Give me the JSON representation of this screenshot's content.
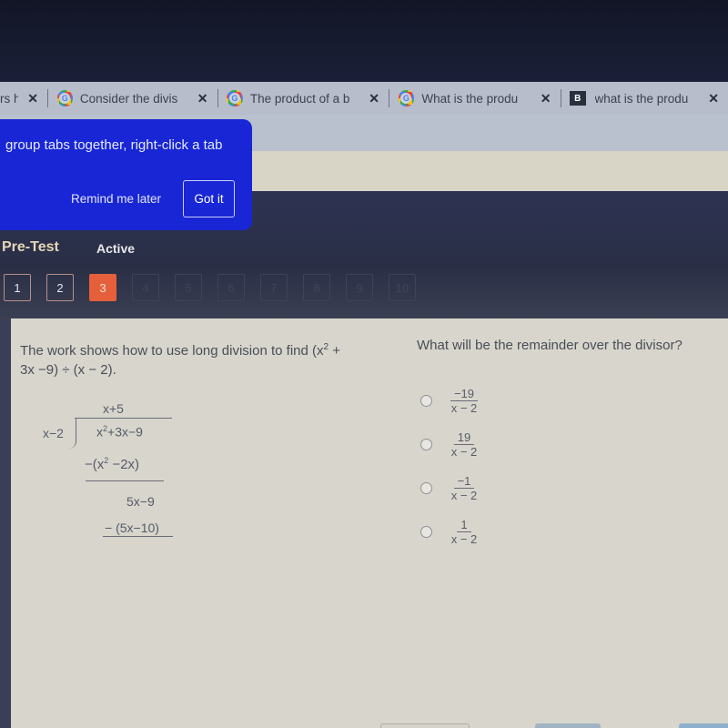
{
  "browser": {
    "tabs": [
      {
        "title": "rs h",
        "icon": "none",
        "close": "✕"
      },
      {
        "title": "Consider the divis",
        "icon": "google-icon",
        "close": "✕"
      },
      {
        "title": "The product of a b",
        "icon": "google-icon",
        "close": "✕"
      },
      {
        "title": "What is the produ",
        "icon": "google-icon",
        "close": "✕"
      },
      {
        "title": "what is the produ",
        "icon": "brainly-icon",
        "close": "✕"
      }
    ],
    "google_glyph": "G",
    "brainly_glyph": "B"
  },
  "popup": {
    "message": "group tabs together, right-click a tab",
    "remind_label": "Remind me later",
    "gotit_label": "Got it",
    "color": "#1826d6"
  },
  "header": {
    "title": "Pre-Test",
    "status": "Active"
  },
  "question_nav": {
    "items": [
      "1",
      "2",
      "3",
      "4",
      "5",
      "6",
      "7",
      "8",
      "9",
      "10"
    ],
    "current": 3,
    "current_color": "#e5603a"
  },
  "question": {
    "line1_pre": "The work shows how to use long division to find (x",
    "line1_sup": "2",
    "line1_post": " +",
    "line2": "3x −9) ÷ (x − 2).",
    "long_division": {
      "quotient": "x+5",
      "divisor": "x−2",
      "dividend_pre": "x",
      "dividend_sup": "2",
      "dividend_post": "+3x−9",
      "step1_pre": "−(x",
      "step1_sup": "2",
      "step1_post": " −2x)",
      "step2": "5x−9",
      "step3": "− (5x−10)"
    }
  },
  "answer": {
    "prompt": "What will be the remainder over the divisor?",
    "options": [
      {
        "numerator": "−19",
        "denominator": "x − 2"
      },
      {
        "numerator": "19",
        "denominator": "x − 2"
      },
      {
        "numerator": "−1",
        "denominator": "x − 2"
      },
      {
        "numerator": "1",
        "denominator": "x − 2"
      }
    ]
  }
}
